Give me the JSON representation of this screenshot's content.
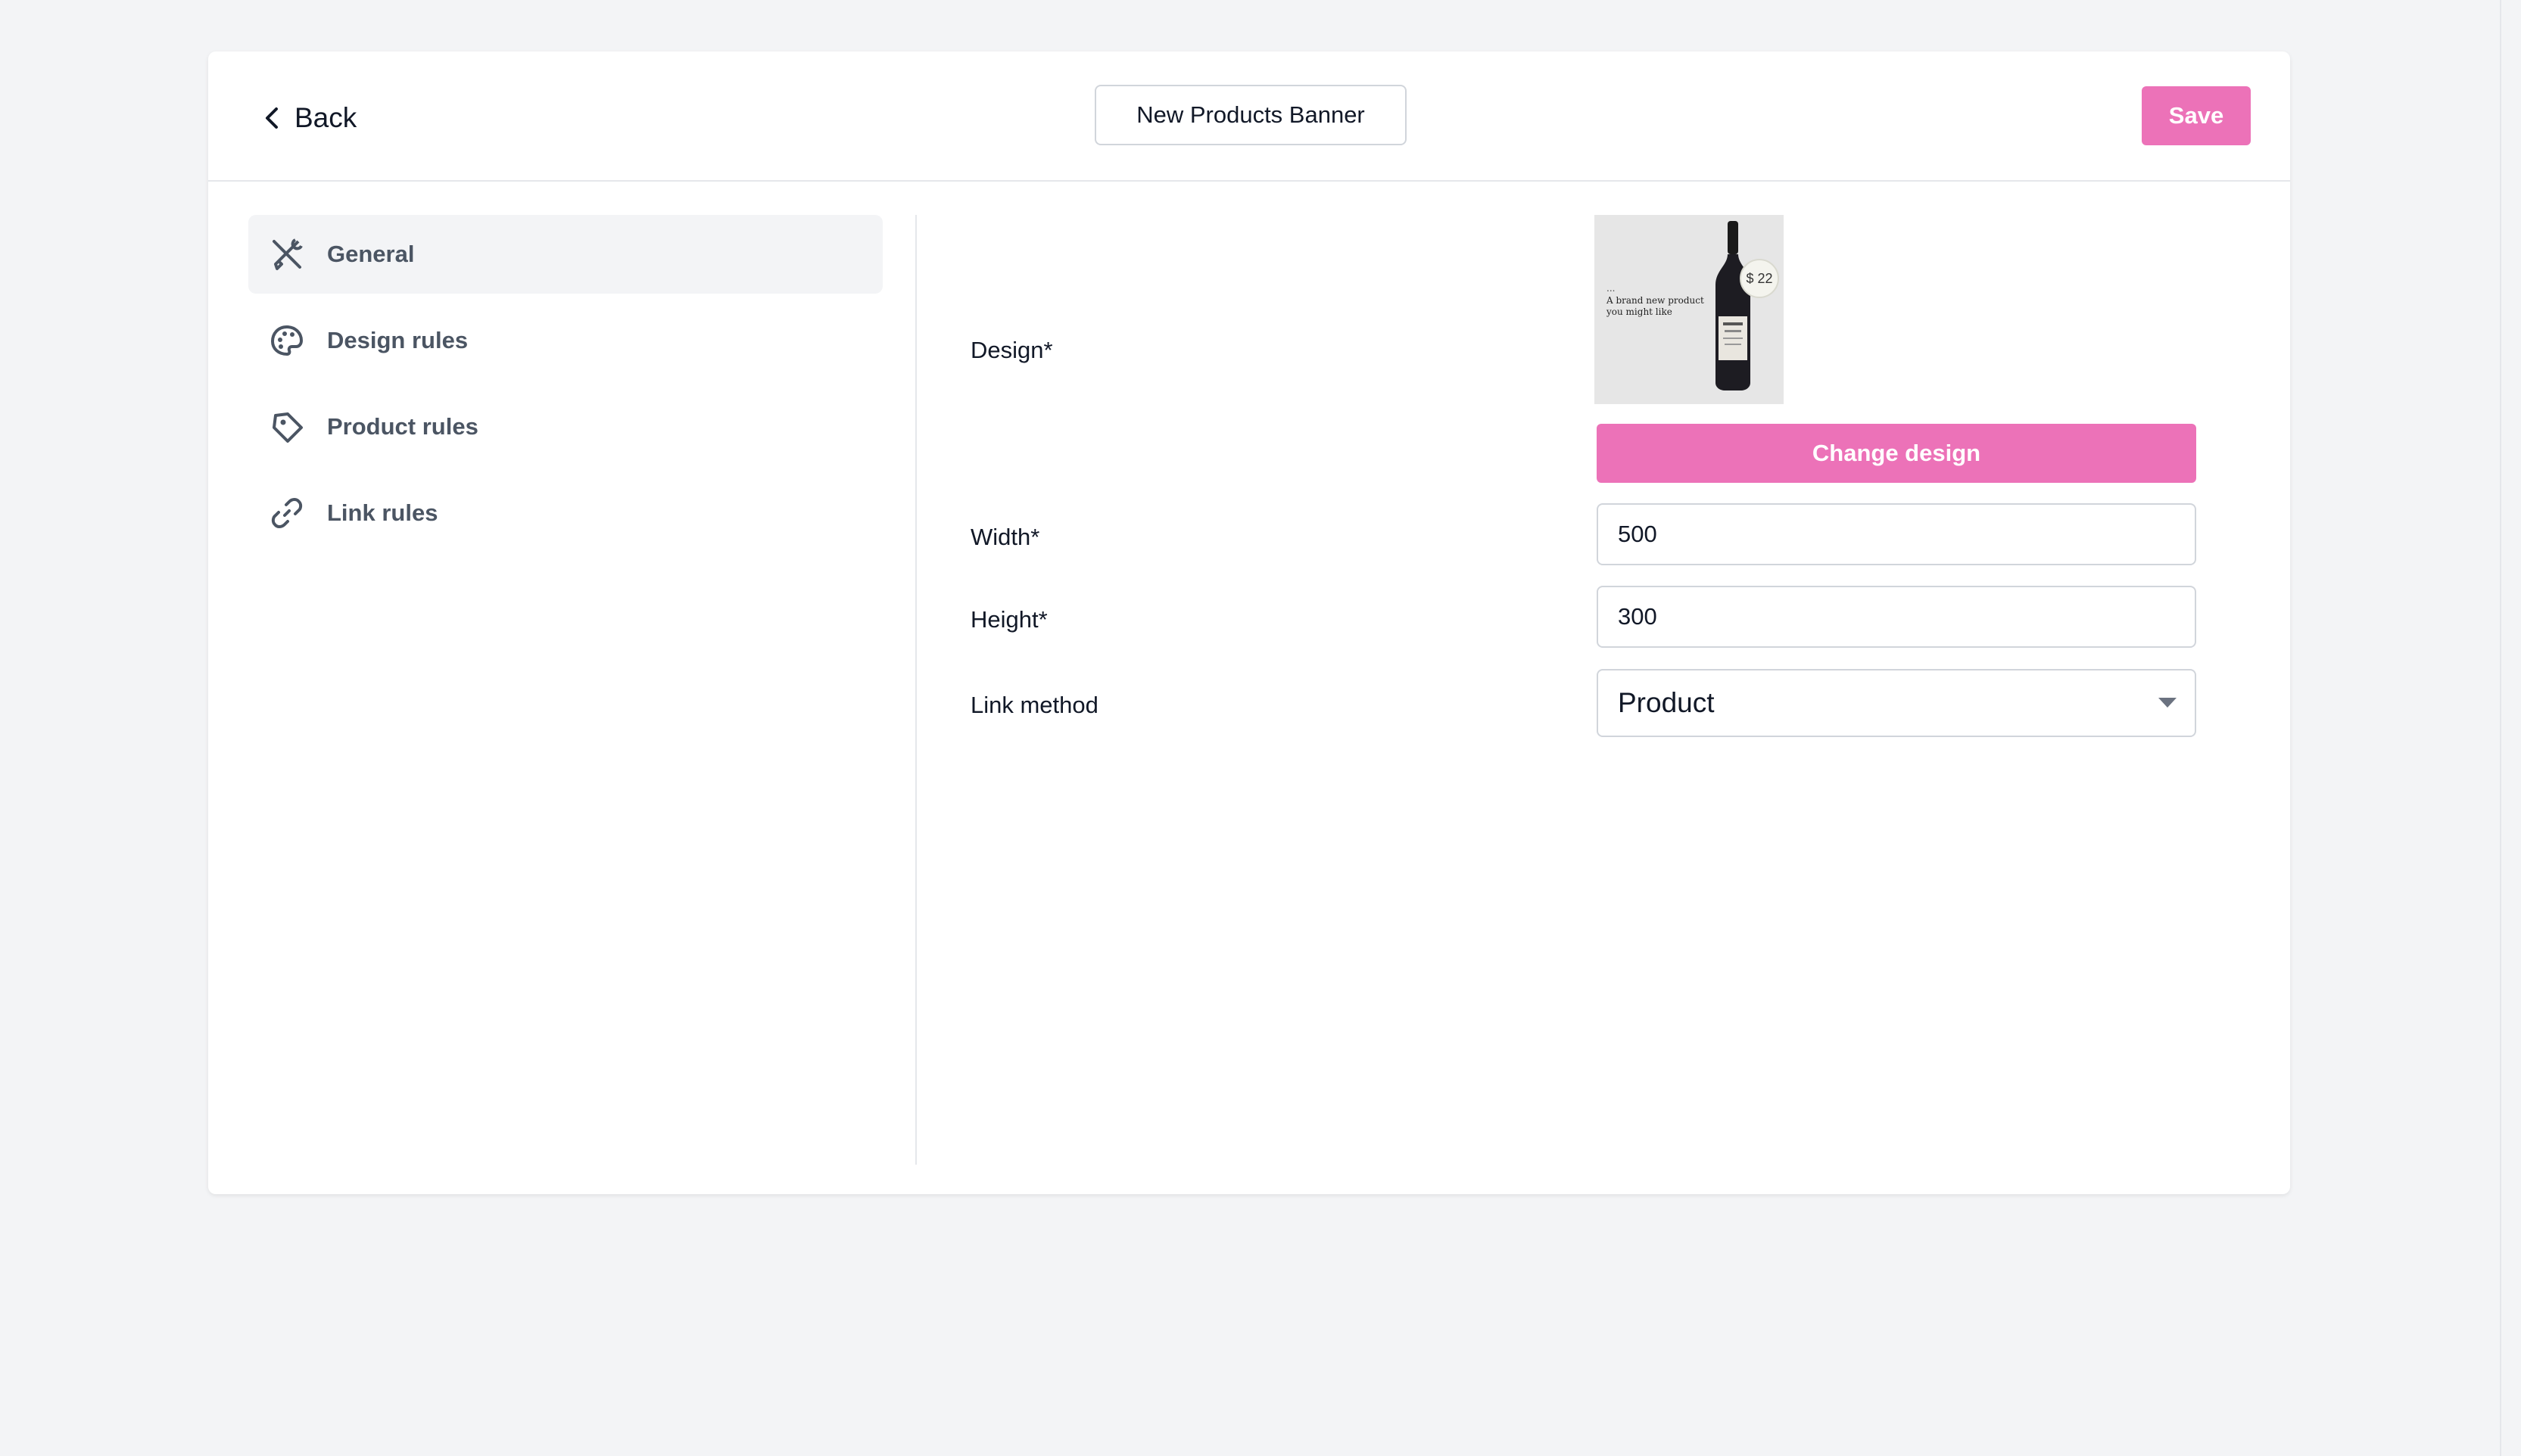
{
  "header": {
    "back_label": "Back",
    "banner_title": "New Products Banner",
    "save_label": "Save"
  },
  "sidebar": {
    "items": [
      {
        "label": "General",
        "icon": "tools-icon",
        "active": true
      },
      {
        "label": "Design rules",
        "icon": "palette-icon",
        "active": false
      },
      {
        "label": "Product rules",
        "icon": "tag-icon",
        "active": false
      },
      {
        "label": "Link rules",
        "icon": "link-icon",
        "active": false
      }
    ]
  },
  "form": {
    "design_label": "Design*",
    "design_preview": {
      "dots": "...",
      "text": "A brand new product you might like",
      "price": "$ 22"
    },
    "change_design_label": "Change design",
    "width_label": "Width*",
    "width_value": "500",
    "height_label": "Height*",
    "height_value": "300",
    "link_method_label": "Link method",
    "link_method_value": "Product"
  },
  "colors": {
    "accent": "#ec72b8",
    "background": "#f3f4f6",
    "card": "#ffffff"
  }
}
